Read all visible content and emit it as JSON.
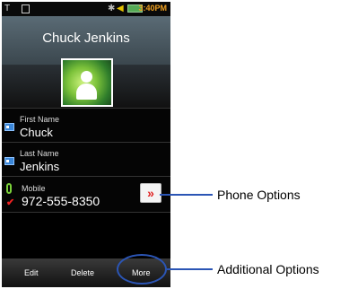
{
  "status_bar": {
    "time": "3:40PM"
  },
  "header": {
    "title": "Chuck Jenkins"
  },
  "contact": {
    "first_name": {
      "label": "First Name",
      "value": "Chuck"
    },
    "last_name": {
      "label": "Last Name",
      "value": "Jenkins"
    },
    "mobile": {
      "label": "Mobile",
      "value": "972-555-8350"
    }
  },
  "softkeys": {
    "edit": "Edit",
    "delete": "Delete",
    "more": "More"
  },
  "callouts": {
    "phone_options": "Phone Options",
    "additional_options": "Additional Options"
  },
  "colors": {
    "annotation": "#2b55b5",
    "option_arrow": "#e02020"
  },
  "icons": {
    "contact_field": "contact-card-icon",
    "phone": "phone-icon",
    "option": "double-chevron-right-icon"
  }
}
